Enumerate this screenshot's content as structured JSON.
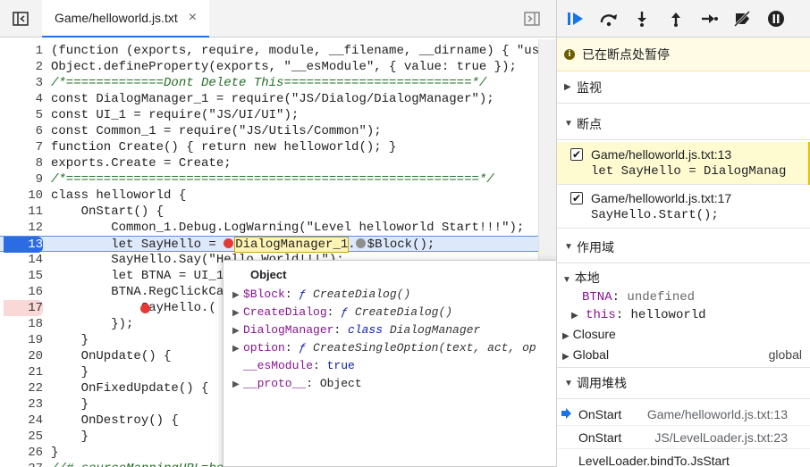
{
  "editor": {
    "tab_title": "Game/helloworld.js.txt",
    "tab_close": "×",
    "lines": [
      {
        "n": "1",
        "t": "(function (exports, require, module, __filename, __dirname) { \"use"
      },
      {
        "n": "2",
        "t": "Object.defineProperty(exports, \"__esModule\", { value: true });"
      },
      {
        "n": "3",
        "t": "/*=============Dont Delete This=========================*/"
      },
      {
        "n": "4",
        "t": "const DialogManager_1 = require(\"JS/Dialog/DialogManager\");"
      },
      {
        "n": "5",
        "t": "const UI_1 = require(\"JS/UI/UI\");"
      },
      {
        "n": "6",
        "t": "const Common_1 = require(\"JS/Utils/Common\");"
      },
      {
        "n": "7",
        "t": "function Create() { return new helloworld(); }"
      },
      {
        "n": "8",
        "t": "exports.Create = Create;"
      },
      {
        "n": "9",
        "t": "/*=======================================================*/"
      },
      {
        "n": "10",
        "t": "class helloworld {"
      },
      {
        "n": "11",
        "t": "    OnStart() {"
      },
      {
        "n": "12",
        "t": "        Common_1.Debug.LogWarning(\"Level helloworld Start!!!\");"
      },
      {
        "n": "13",
        "t": "        let SayHello = "
      },
      {
        "n": "14",
        "t": "        SayHello.Say(\"Hello World!!!\");"
      },
      {
        "n": "15",
        "t": "        let BTNA = UI_1"
      },
      {
        "n": "16",
        "t": "        BTNA.RegClickCal"
      },
      {
        "n": "17",
        "t": "            SayHello.("
      },
      {
        "n": "18",
        "t": "        });"
      },
      {
        "n": "19",
        "t": "    }"
      },
      {
        "n": "20",
        "t": "    OnUpdate() {"
      },
      {
        "n": "21",
        "t": "    }"
      },
      {
        "n": "22",
        "t": "    OnFixedUpdate() {"
      },
      {
        "n": "23",
        "t": "    }"
      },
      {
        "n": "24",
        "t": "    OnDestroy() {"
      },
      {
        "n": "25",
        "t": "    }"
      },
      {
        "n": "26",
        "t": "}"
      },
      {
        "n": "27",
        "t": "//# sourceMappingURL=hel"
      }
    ],
    "line13_highlight": "DialogManager_1",
    "line13_dot": ".",
    "line13_rest": "$Block();"
  },
  "popover": {
    "title": "Object",
    "props": [
      {
        "tri": "▶",
        "key": "$Block",
        "sep": ": ",
        "fsym": "ƒ ",
        "val": "CreateDialog()"
      },
      {
        "tri": "▶",
        "key": "CreateDialog",
        "sep": ": ",
        "fsym": "ƒ ",
        "val": "CreateDialog()"
      },
      {
        "tri": "▶",
        "key": "DialogManager",
        "sep": ": ",
        "fsym": "class ",
        "val": "DialogManager"
      },
      {
        "tri": "▶",
        "key": "option",
        "sep": ": ",
        "fsym": "ƒ ",
        "val": "CreateSingleOption(text, act, op"
      },
      {
        "tri": "",
        "key": "__esModule",
        "sep": ": ",
        "fsym": "",
        "val": "true"
      },
      {
        "tri": "▶",
        "key": "__proto__",
        "sep": ": ",
        "fsym": "",
        "val": "Object"
      }
    ]
  },
  "debugger": {
    "paused_text": "已在断点处暂停",
    "watch_label": "监视",
    "breakpoints_label": "断点",
    "breakpoints": [
      {
        "file": "Game/helloworld.js.txt:13",
        "code": "let SayHello = DialogManag",
        "checked": "✔",
        "active": true
      },
      {
        "file": "Game/helloworld.js.txt:17",
        "code": "SayHello.Start();",
        "checked": "✔",
        "active": false
      }
    ],
    "scope_label": "作用域",
    "scope": {
      "local_label": "本地",
      "btna_key": "BTNA",
      "btna_val": "undefined",
      "this_key": "this",
      "this_val": "helloworld",
      "closure_label": "Closure",
      "global_label": "Global",
      "global_val": "global"
    },
    "callstack_label": "调用堆栈",
    "frames": [
      {
        "name": "OnStart",
        "loc": "Game/helloworld.js.txt:13"
      },
      {
        "name": "OnStart",
        "loc": "JS/LevelLoader.js.txt:23"
      },
      {
        "name": "LevelLoader.bindTo.JsStart",
        "loc": ""
      }
    ]
  },
  "colors": {
    "accent": "#1a73e8",
    "breakpoint_red": "#e53935",
    "paused_bg": "#fffbe5"
  }
}
